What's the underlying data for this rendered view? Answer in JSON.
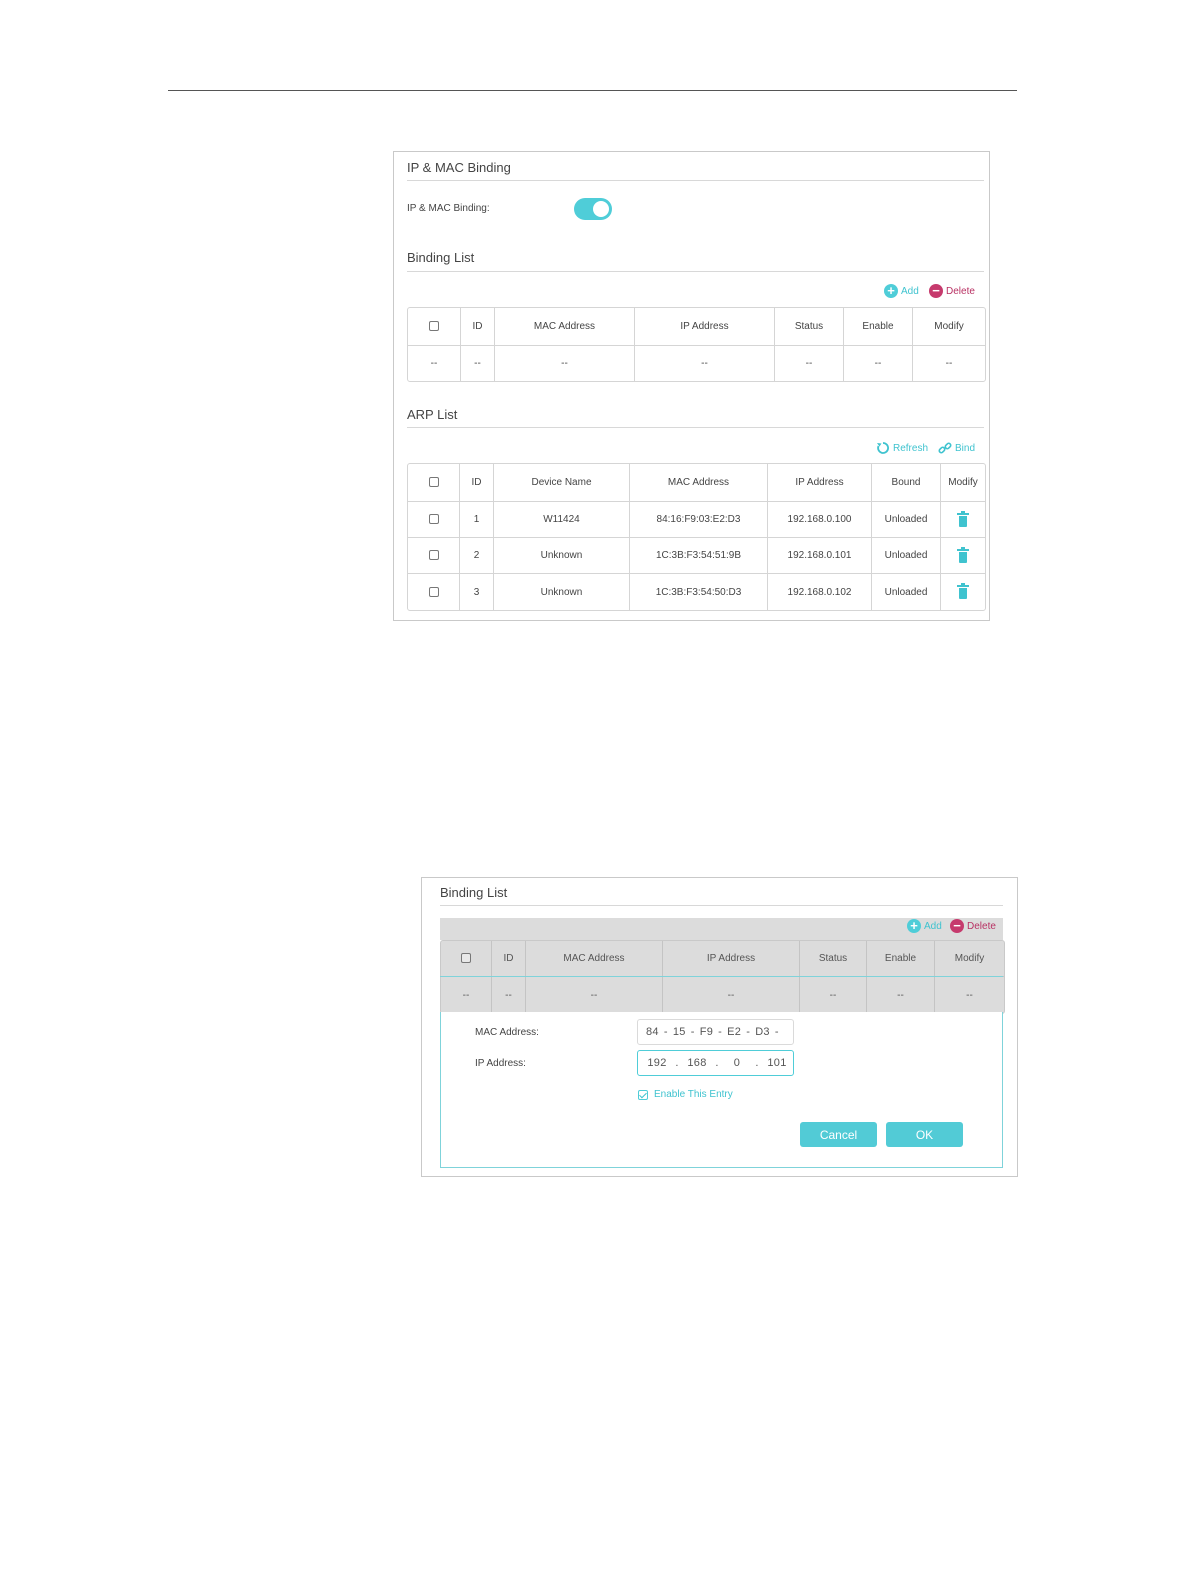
{
  "ip_mac_binding": {
    "title": "IP & MAC Binding",
    "toggle_label": "IP & MAC Binding:",
    "toggle_on": true
  },
  "binding_list": {
    "title": "Binding List",
    "add_label": "Add",
    "delete_label": "Delete",
    "columns": [
      "ID",
      "MAC Address",
      "IP Address",
      "Status",
      "Enable",
      "Modify"
    ],
    "empty_cell": "--"
  },
  "arp_list": {
    "title": "ARP List",
    "refresh_label": "Refresh",
    "bind_label": "Bind",
    "columns": [
      "ID",
      "Device Name",
      "MAC Address",
      "IP Address",
      "Bound",
      "Modify"
    ],
    "rows": [
      {
        "id": "1",
        "device_name": "W11424",
        "mac": "84:16:F9:03:E2:D3",
        "ip": "192.168.0.100",
        "bound": "Unloaded"
      },
      {
        "id": "2",
        "device_name": "Unknown",
        "mac": "1C:3B:F3:54:51:9B",
        "ip": "192.168.0.101",
        "bound": "Unloaded"
      },
      {
        "id": "3",
        "device_name": "Unknown",
        "mac": "1C:3B:F3:54:50:D3",
        "ip": "192.168.0.102",
        "bound": "Unloaded"
      }
    ]
  },
  "edit_form": {
    "title": "Binding List",
    "add_label": "Add",
    "delete_label": "Delete",
    "columns": [
      "ID",
      "MAC Address",
      "IP Address",
      "Status",
      "Enable",
      "Modify"
    ],
    "empty_cell": "--",
    "mac_label": "MAC Address:",
    "mac_segments": [
      "84",
      "15",
      "F9",
      "E2",
      "D3"
    ],
    "mac_sep": "-",
    "ip_label": "IP Address:",
    "ip_segments": [
      "192",
      "168",
      "0",
      "101"
    ],
    "ip_sep": ".",
    "enable_label": "Enable This Entry",
    "cancel_label": "Cancel",
    "ok_label": "OK"
  },
  "colors": {
    "accent": "#4fcdd8",
    "delete": "#c63a6d"
  }
}
